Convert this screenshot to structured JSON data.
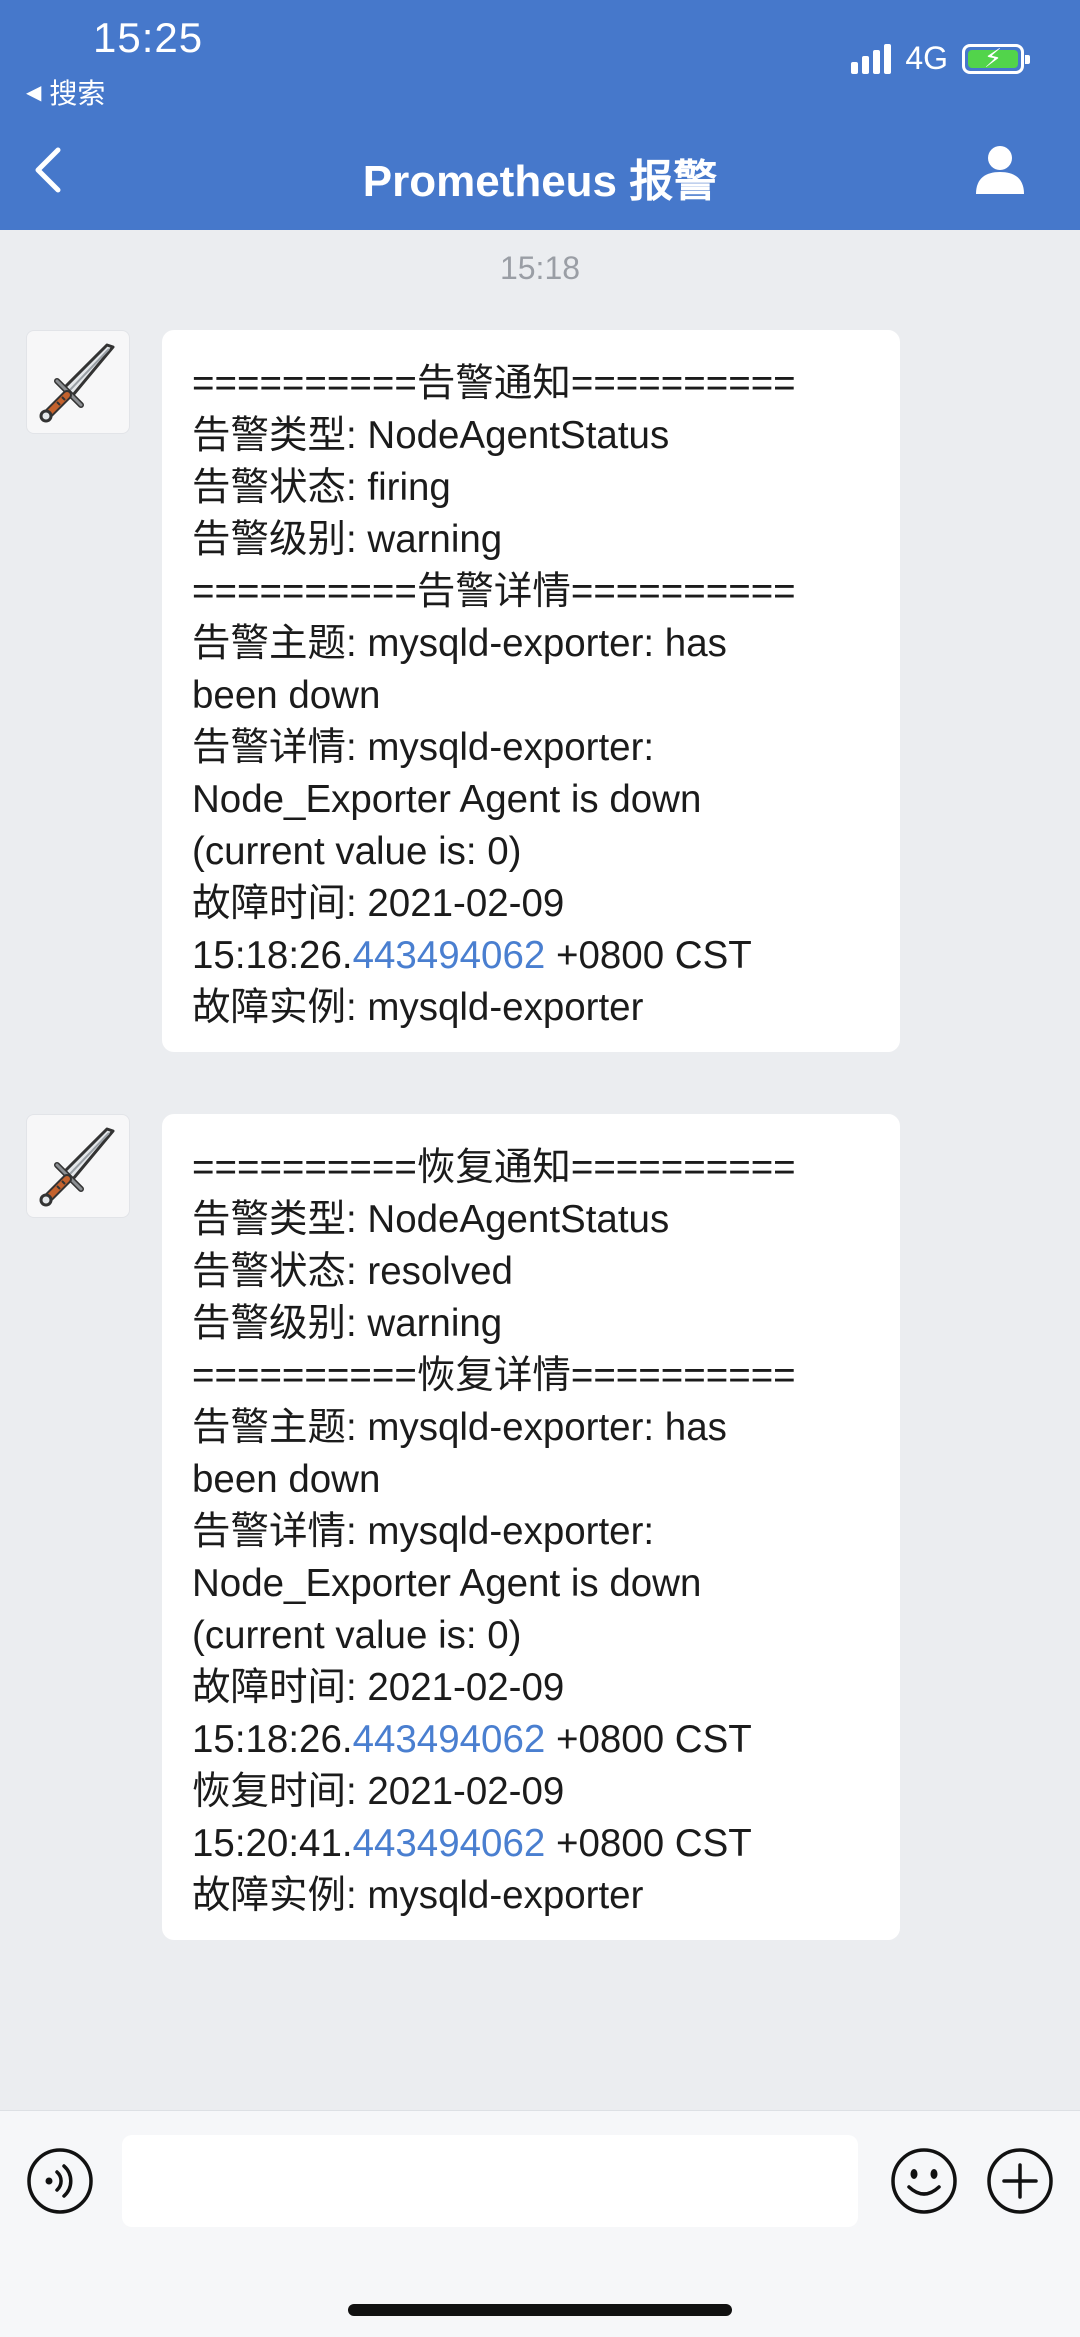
{
  "status_bar": {
    "time": "15:25",
    "back_label": "搜索",
    "network": "4G"
  },
  "nav": {
    "title": "Prometheus 报警"
  },
  "chat": {
    "timestamp": "15:18",
    "messages": [
      {
        "sender_icon": "sword-icon",
        "lines": [
          {
            "text": "==========告警通知=========="
          },
          {
            "text": "告警类型: NodeAgentStatus"
          },
          {
            "text": "告警状态: firing"
          },
          {
            "text": "告警级别: warning"
          },
          {
            "text": "==========告警详情=========="
          },
          {
            "text": "告警主题: mysqld-exporter: has"
          },
          {
            "text": "been down"
          },
          {
            "text": "告警详情: mysqld-exporter:"
          },
          {
            "text": "Node_Exporter Agent is down"
          },
          {
            "text": "(current value is: 0)"
          },
          {
            "text": "故障时间: 2021-02-09"
          },
          {
            "pre": "15:18:26.",
            "link": "443494062",
            "post": " +0800 CST"
          },
          {
            "text": "故障实例: mysqld-exporter"
          }
        ]
      },
      {
        "sender_icon": "sword-icon",
        "lines": [
          {
            "text": "==========恢复通知=========="
          },
          {
            "text": "告警类型: NodeAgentStatus"
          },
          {
            "text": "告警状态: resolved"
          },
          {
            "text": "告警级别: warning"
          },
          {
            "text": "==========恢复详情=========="
          },
          {
            "text": "告警主题: mysqld-exporter: has"
          },
          {
            "text": "been down"
          },
          {
            "text": "告警详情: mysqld-exporter:"
          },
          {
            "text": "Node_Exporter Agent is down"
          },
          {
            "text": "(current value is: 0)"
          },
          {
            "text": "故障时间: 2021-02-09"
          },
          {
            "pre": "15:18:26.",
            "link": "443494062",
            "post": " +0800 CST"
          },
          {
            "text": "恢复时间: 2021-02-09"
          },
          {
            "pre": "15:20:41.",
            "link": "443494062",
            "post": " +0800 CST"
          },
          {
            "text": "故障实例: mysqld-exporter"
          }
        ]
      }
    ]
  },
  "colors": {
    "header_bg": "#4678cb",
    "chat_bg": "#ebedf0",
    "link": "#4a7fd0",
    "battery": "#52d44b"
  },
  "input_bar": {
    "voice_icon": "voice-icon",
    "emoji_icon": "emoji-icon",
    "plus_icon": "plus-icon"
  }
}
